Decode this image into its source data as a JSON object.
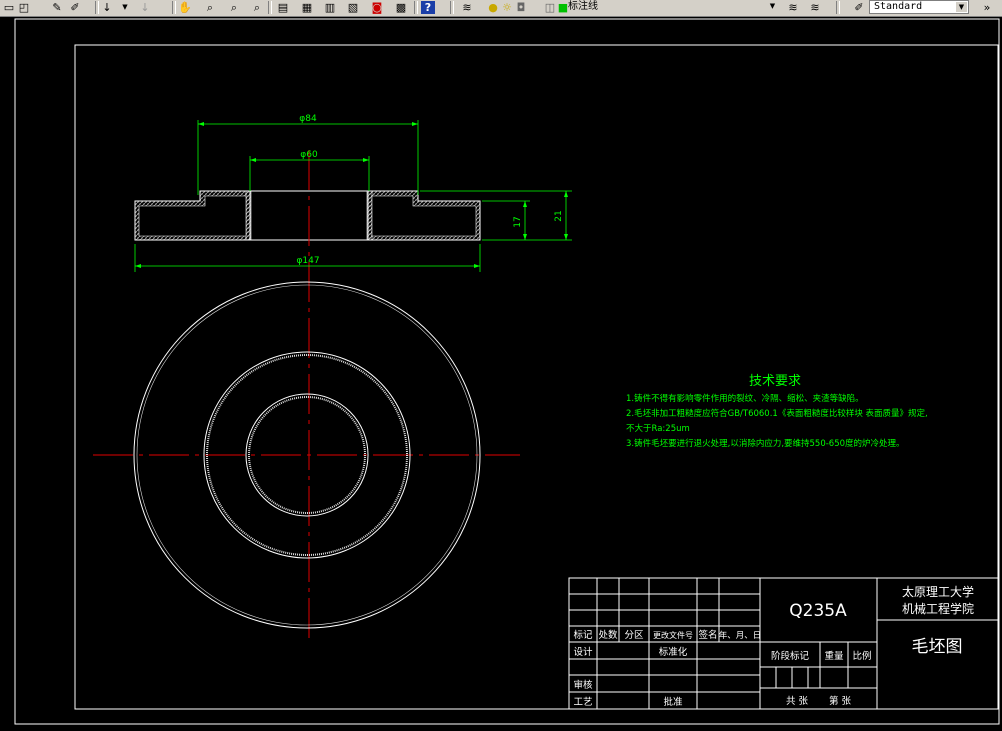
{
  "toolbar": {
    "layer_name": "标注线",
    "style_name": "Standard",
    "icons": [
      "new-icon",
      "open-icon",
      "pencil-icon",
      "match-properties-icon",
      "undo-icon",
      "redo-icon",
      "pan-icon",
      "zoom-realtime-icon",
      "zoom-window-icon",
      "zoom-previous-icon",
      "properties-icon",
      "design-center-icon",
      "tool-palette-icon",
      "sheet-set-icon",
      "markup-icon",
      "quickcalc-icon",
      "help-icon",
      "layer-manager-icon",
      "layer-state-icons",
      "layer-previous-icon",
      "text-style-icon"
    ]
  },
  "drawing": {
    "dims": {
      "d84": "φ84",
      "d60": "φ60",
      "d147": "φ147",
      "h17": "17",
      "h21": "21"
    },
    "tech_req": {
      "title": "技术要求",
      "line1": "1.铸件不得有影响零件作用的裂纹、冷隔、缩松、夹渣等缺陷。",
      "line2": "2.毛坯非加工粗糙度应符合GB/T6060.1《表面粗糙度比较样块 表面质量》规定,",
      "line3": "不大于Ra:25um",
      "line4": "3.铸件毛坯要进行退火处理,以消除内应力,要维持550-650度的炉冷处理。"
    },
    "title_block": {
      "material": "Q235A",
      "school_line1": "太原理工大学",
      "school_line2": "机械工程学院",
      "drawing_name": "毛坯图",
      "headers": [
        "标记",
        "处数",
        "分区",
        "更改文件号",
        "签名",
        "年、月、日"
      ],
      "design": "设计",
      "standardize": "标准化",
      "review": "审核",
      "process": "工艺",
      "approve": "批准",
      "stage_mark": "阶段标记",
      "weight": "重量",
      "scale": "比例",
      "sheets_total": "共  张",
      "sheet_no": "第  张"
    }
  },
  "colors": {
    "canvas": "#000000",
    "lines": "#ffffff",
    "dimension": "#00ff00",
    "center": "#ff0000",
    "title_text": "#ffffff"
  }
}
